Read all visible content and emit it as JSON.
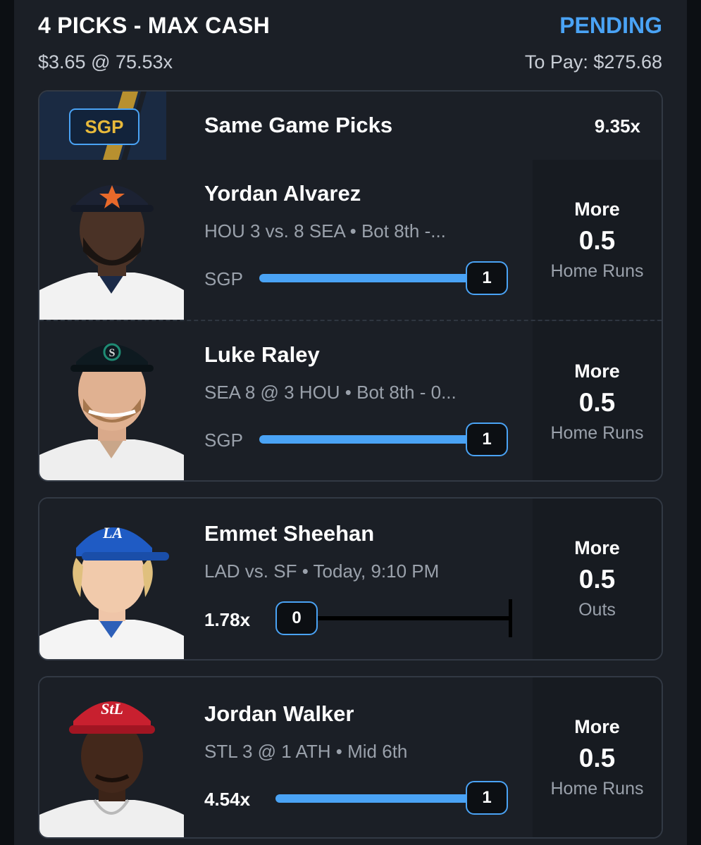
{
  "header": {
    "title": "4 PICKS - MAX CASH",
    "status": "PENDING",
    "wager": "$3.65 @ 75.53x",
    "to_pay": "To Pay: $275.68"
  },
  "sgp": {
    "badge": "SGP",
    "label": "Same Game Picks",
    "multiplier": "9.35x",
    "accent_color": "#e7b93b"
  },
  "picks": [
    {
      "name": "Yordan Alvarez",
      "game": "HOU 3 vs. 8 SEA • Bot 8th  -...",
      "left_label": "SGP",
      "progress_value": "1",
      "progress_fraction": 1.0,
      "direction": "More",
      "line": "0.5",
      "stat": "Home Runs",
      "team_icon": "astros-cap-icon"
    },
    {
      "name": "Luke Raley",
      "game": "SEA 8 @ 3 HOU • Bot 8th  -  0...",
      "left_label": "SGP",
      "progress_value": "1",
      "progress_fraction": 1.0,
      "direction": "More",
      "line": "0.5",
      "stat": "Home Runs",
      "team_icon": "mariners-cap-icon"
    },
    {
      "name": "Emmet Sheehan",
      "game": "LAD vs. SF • Today, 9:10 PM",
      "left_label": "1.78x",
      "progress_value": "0",
      "progress_fraction": 0.0,
      "direction": "More",
      "line": "0.5",
      "stat": "Outs",
      "team_icon": "dodgers-cap-icon"
    },
    {
      "name": "Jordan Walker",
      "game": "STL 3 @ 1 ATH • Mid 6th",
      "left_label": "4.54x",
      "progress_value": "1",
      "progress_fraction": 1.0,
      "direction": "More",
      "line": "0.5",
      "stat": "Home Runs",
      "team_icon": "cardinals-cap-icon"
    }
  ],
  "colors": {
    "accent_blue": "#4aa3f5",
    "background": "#1b1f26"
  }
}
